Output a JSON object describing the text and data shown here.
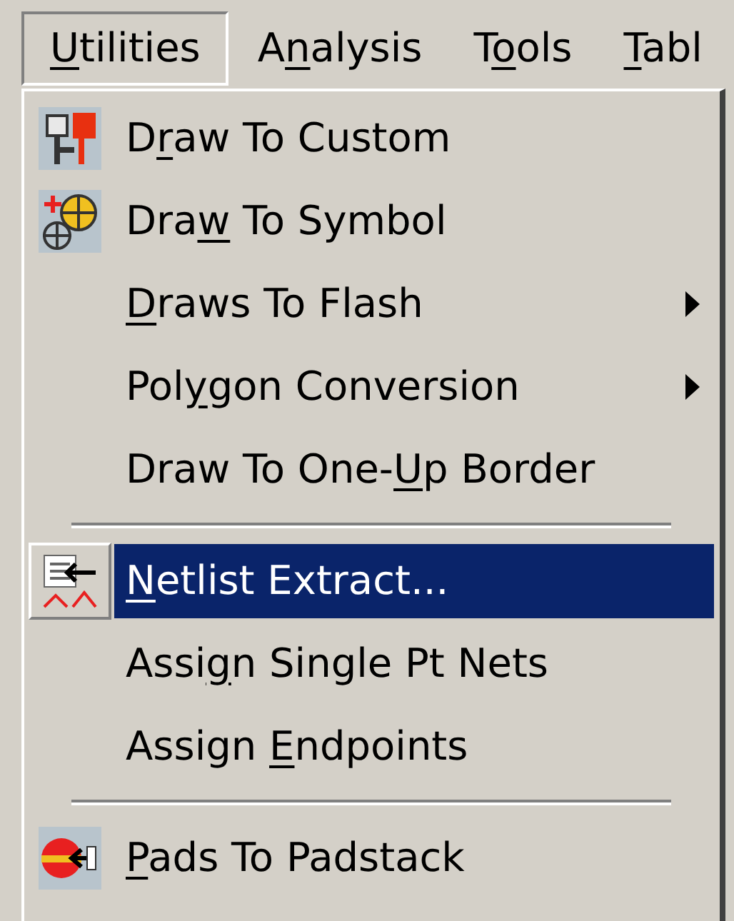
{
  "menu_bar": [
    {
      "key": "U",
      "after": "tilities",
      "selected": true
    },
    {
      "before": "A",
      "key": "n",
      "after": "alysis",
      "selected": false
    },
    {
      "before": "T",
      "key": "o",
      "after": "ols",
      "selected": false
    },
    {
      "key": "T",
      "after": "abl",
      "selected": false
    }
  ],
  "menu": [
    {
      "kind": "icon_item",
      "before": "D",
      "key": "r",
      "after": "aw To Custom",
      "submenu": false,
      "selected": false
    },
    {
      "kind": "icon_item",
      "before": "Dra",
      "key": "w",
      "after": " To Symbol",
      "submenu": false,
      "selected": false
    },
    {
      "kind": "item",
      "key": "D",
      "after": "raws To Flash",
      "submenu": true,
      "selected": false
    },
    {
      "kind": "item",
      "before": "Pol",
      "key": "y",
      "after": "gon Conversion",
      "submenu": true,
      "selected": false
    },
    {
      "kind": "item",
      "before": "Draw To One-",
      "key": "U",
      "after": "p Border",
      "submenu": false,
      "selected": false
    },
    {
      "kind": "separator"
    },
    {
      "kind": "icon_item",
      "key": "N",
      "after": "etlist Extract...",
      "submenu": false,
      "selected": true
    },
    {
      "kind": "item",
      "before": "Assi",
      "key": "g",
      "after": "n Single Pt Nets",
      "submenu": false,
      "selected": false
    },
    {
      "kind": "item",
      "before": "Assign ",
      "key": "E",
      "after": "ndpoints",
      "submenu": false,
      "selected": false
    },
    {
      "kind": "separator"
    },
    {
      "kind": "icon_item",
      "key": "P",
      "after": "ads To Padstack",
      "submenu": false,
      "selected": false
    }
  ]
}
